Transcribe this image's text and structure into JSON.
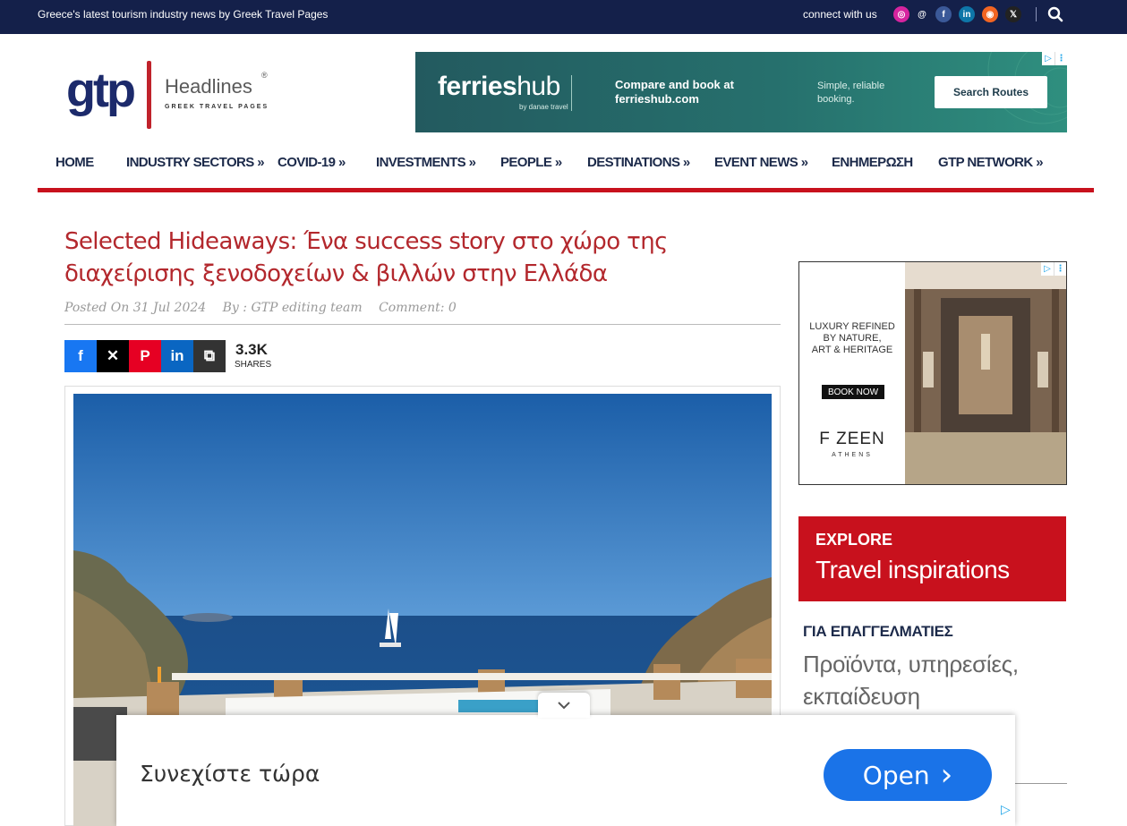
{
  "topbar": {
    "tagline": "Greece's latest tourism industry news by Greek Travel Pages",
    "connect_label": "connect with us",
    "social": [
      {
        "name": "instagram-icon",
        "glyph": "◎",
        "color": "#d6249f"
      },
      {
        "name": "threads-icon",
        "glyph": "@",
        "color": "#14204a"
      },
      {
        "name": "facebook-icon",
        "glyph": "f",
        "color": "#3b5998"
      },
      {
        "name": "linkedin-icon",
        "glyph": "in",
        "color": "#0e76a8"
      },
      {
        "name": "rss-icon",
        "glyph": "◉",
        "color": "#f26522"
      },
      {
        "name": "x-icon",
        "glyph": "𝕏",
        "color": "#222222"
      }
    ]
  },
  "logo": {
    "gtp": "gtp",
    "headlines": "Headlines",
    "registered": "®",
    "subtitle": "GREEK TRAVEL PAGES"
  },
  "banner_ad": {
    "brand_bold": "ferries",
    "brand_light": "hub",
    "by": "by danae travel",
    "headline": "Compare and book at ferrieshub.com",
    "tagline": "Simple, reliable booking.",
    "button": "Search Routes"
  },
  "nav": {
    "items": [
      "HOME",
      "INDUSTRY SECTORS »",
      "COVID-19 »",
      "INVESTMENTS »",
      "PEOPLE »",
      "DESTINATIONS »",
      "EVENT NEWS »",
      "ΕΝΗΜΕΡΩΣΗ",
      "GTP NETWORK »"
    ]
  },
  "article": {
    "title": "Selected Hideaways: Ένα success story στο χώρο της διαχείρισης ξενοδοχείων & βιλλών στην Ελλάδα",
    "posted": "Posted On 31 Jul 2024",
    "author": "By : GTP editing team",
    "comments": "Comment: 0",
    "share_count": "3.3K",
    "share_label": "SHARES",
    "share_buttons": [
      {
        "name": "share-facebook-button",
        "glyph": "f",
        "color": "#1877f2"
      },
      {
        "name": "share-x-button",
        "glyph": "✕",
        "color": "#000000"
      },
      {
        "name": "share-pinterest-button",
        "glyph": "P",
        "color": "#e60023"
      },
      {
        "name": "share-linkedin-button",
        "glyph": "in",
        "color": "#0a66c2"
      },
      {
        "name": "share-copy-button",
        "glyph": "⧉",
        "color": "#333333"
      }
    ]
  },
  "sidebar_ad": {
    "line1": "LUXURY REFINED",
    "line2": "BY NATURE,",
    "line3": "ART & HERITAGE",
    "button": "BOOK NOW",
    "brand": "F ZEEN",
    "city": "ATHENS"
  },
  "sidebar": {
    "explore_small": "EXPLORE",
    "explore_big": "Travel inspirations",
    "pro_heading": "ΓΙΑ ΕΠΑΓΓΕΛΜΑΤΙΕΣ",
    "pro_text": "Προϊόντα, υπηρεσίες, εκπαίδευση"
  },
  "sticky_ad": {
    "text": "Συνεχίστε τώρα",
    "button": "Open",
    "button_icon": "›"
  }
}
